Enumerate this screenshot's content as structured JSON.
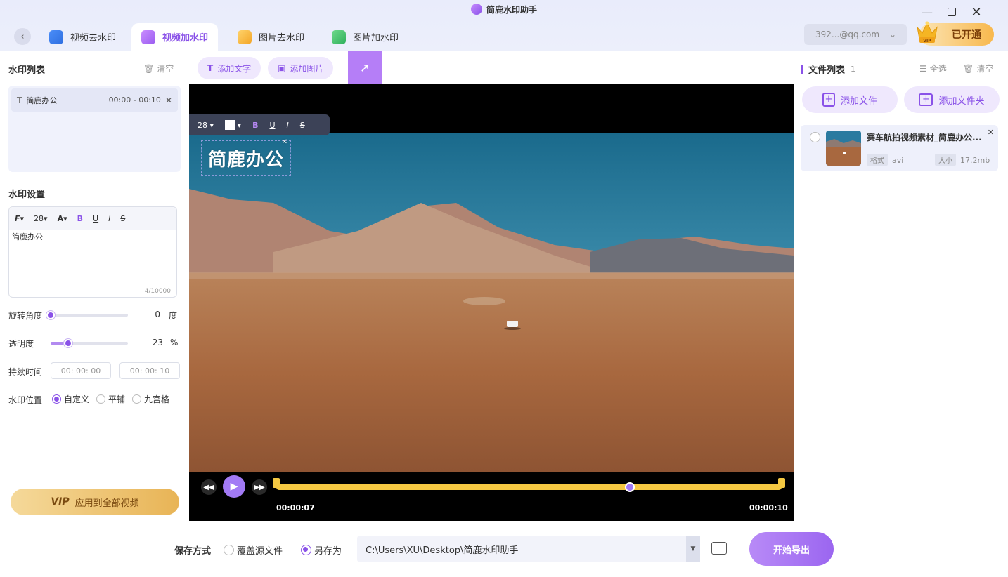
{
  "app": {
    "title": "简鹿水印助手"
  },
  "tabs": [
    {
      "label": "视频去水印"
    },
    {
      "label": "视频加水印"
    },
    {
      "label": "图片去水印"
    },
    {
      "label": "图片加水印"
    }
  ],
  "account": {
    "email": "392...@qq.com",
    "vip_label": "已开通",
    "vip_badge": "VIP"
  },
  "left": {
    "watermark_list_title": "水印列表",
    "clear_label": "清空",
    "items": [
      {
        "text": "简鹿办公",
        "time": "00:00 - 00:10"
      }
    ],
    "settings_title": "水印设置",
    "font_size": "28",
    "text_value": "简鹿办公",
    "char_count": "4/10000",
    "rotation_label": "旋转角度",
    "rotation_value": "0",
    "rotation_unit": "度",
    "rotation_fraction": 0,
    "opacity_label": "透明度",
    "opacity_value": "23",
    "opacity_unit": "%",
    "opacity_fraction": 0.23,
    "duration_label": "持续时间",
    "duration_start": "00: 00: 00",
    "duration_sep": "-",
    "duration_end": "00: 00: 10",
    "position_label": "水印位置",
    "position_options": [
      "自定义",
      "平铺",
      "九宫格"
    ],
    "position_selected": "自定义",
    "apply_vip": "VIP",
    "apply_label": "应用到全部视频"
  },
  "center": {
    "add_text": "添加文字",
    "add_image": "添加图片",
    "toolbar_font_size": "28",
    "watermark_text": "简鹿办公",
    "current_time": "00:00:07",
    "end_time": "00:00:10",
    "progress_fraction": 0.7
  },
  "right": {
    "file_list_title": "文件列表",
    "file_count": "1",
    "select_all": "全选",
    "clear_label": "清空",
    "add_file": "添加文件",
    "add_folder": "添加文件夹",
    "files": [
      {
        "name": "赛车航拍视频素材_简鹿办公...",
        "format_label": "格式",
        "format": "avi",
        "size_label": "大小",
        "size": "17.2mb"
      }
    ]
  },
  "bottom": {
    "save_mode_label": "保存方式",
    "option_overwrite": "覆盖源文件",
    "option_save_as": "另存为",
    "selected": "另存为",
    "path": "C:\\Users\\XU\\Desktop\\简鹿水印助手",
    "export_label": "开始导出"
  },
  "colors": {
    "accent": "#8a52e8",
    "accent_light": "#efe8fd",
    "progress": "#f4c842",
    "vip": "#e8b456"
  }
}
